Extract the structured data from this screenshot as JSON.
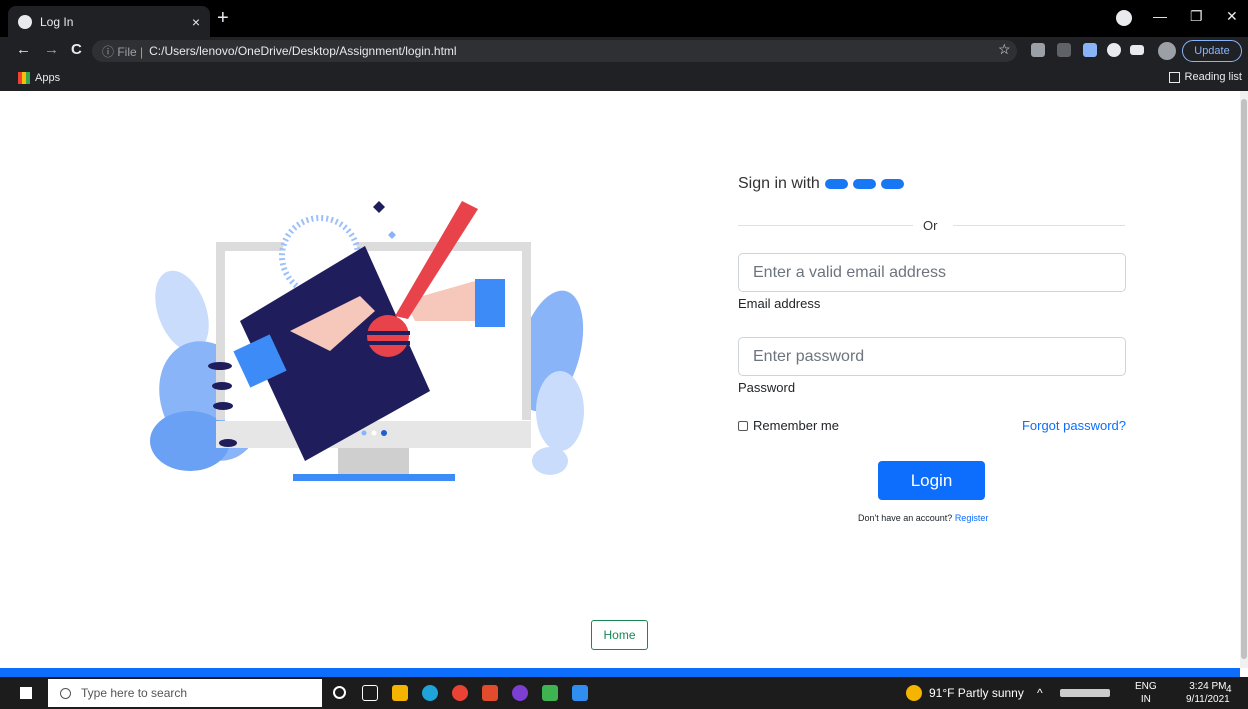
{
  "browser": {
    "tab_title": "Log In",
    "tab_close": "×",
    "new_tab": "+",
    "url_scheme": "ⓘ File |",
    "url": "C:/Users/lenovo/OneDrive/Desktop/Assignment/login.html",
    "update_label": "Update",
    "apps_label": "Apps",
    "reading_list_label": "Reading list",
    "back": "←",
    "forward": "→",
    "reload": "C",
    "star": "☆",
    "minimize": "—",
    "maximize": "❐",
    "close": "✕"
  },
  "form": {
    "signin_label": "Sign in with",
    "or_label": "Or",
    "email_placeholder": "Enter a valid email address",
    "email_label": "Email address",
    "password_placeholder": "Enter password",
    "password_label": "Password",
    "remember_label": "Remember me",
    "forgot_label": "Forgot password?",
    "login_label": "Login",
    "register_prompt": "Don't have an account?",
    "register_link": "Register"
  },
  "footer": {
    "home_label": "Home"
  },
  "taskbar": {
    "search_placeholder": "Type here to search",
    "weather": "91°F  Partly sunny",
    "lang_top": "ENG",
    "lang_bottom": "IN",
    "time": "3:24 PM",
    "date": "9/11/2021",
    "notifications": "4"
  },
  "colors": {
    "accent": "#0d6efd",
    "home_green": "#198754",
    "illustration_navy": "#1f1d5c",
    "illustration_red": "#e8424a"
  }
}
